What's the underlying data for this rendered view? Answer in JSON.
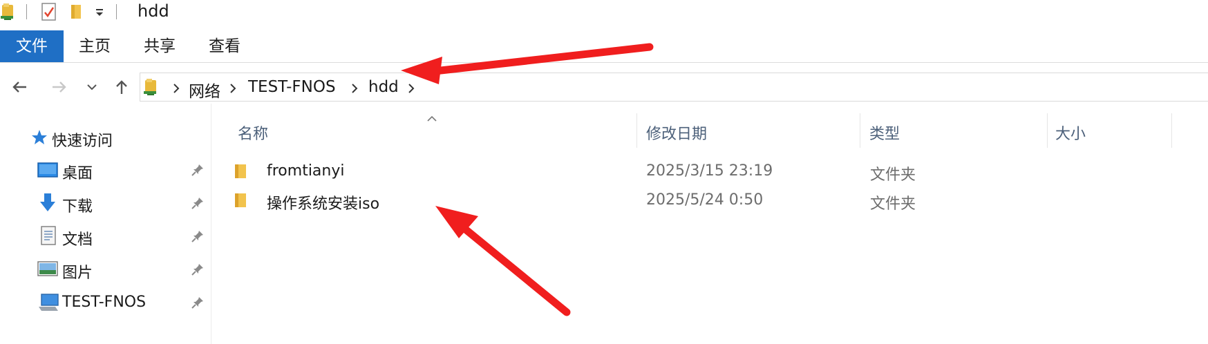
{
  "window": {
    "title": "hdd"
  },
  "ribbon": {
    "tabs": [
      "文件",
      "主页",
      "共享",
      "查看"
    ],
    "active_index": 0
  },
  "address": {
    "crumbs": [
      "网络",
      "TEST-FNOS",
      "hdd"
    ]
  },
  "sidebar": {
    "items": [
      {
        "label": "快速访问",
        "icon": "star-icon",
        "pinned": false
      },
      {
        "label": "桌面",
        "icon": "desktop-icon",
        "pinned": true
      },
      {
        "label": "下载",
        "icon": "download-icon",
        "pinned": true
      },
      {
        "label": "文档",
        "icon": "document-icon",
        "pinned": true
      },
      {
        "label": "图片",
        "icon": "pictures-icon",
        "pinned": true
      },
      {
        "label": "TEST-FNOS",
        "icon": "network-computer-icon",
        "pinned": true
      }
    ]
  },
  "filelist": {
    "columns": [
      "名称",
      "修改日期",
      "类型",
      "大小"
    ],
    "rows": [
      {
        "name": "fromtianyi",
        "modified": "2025/3/15 23:19",
        "type": "文件夹",
        "size": ""
      },
      {
        "name": "操作系统安装iso",
        "modified": "2025/5/24 0:50",
        "type": "文件夹",
        "size": ""
      }
    ]
  },
  "colors": {
    "accent": "#1f6fc5",
    "folder": "#f2c34d",
    "annotation_arrow": "#f01e1e"
  }
}
